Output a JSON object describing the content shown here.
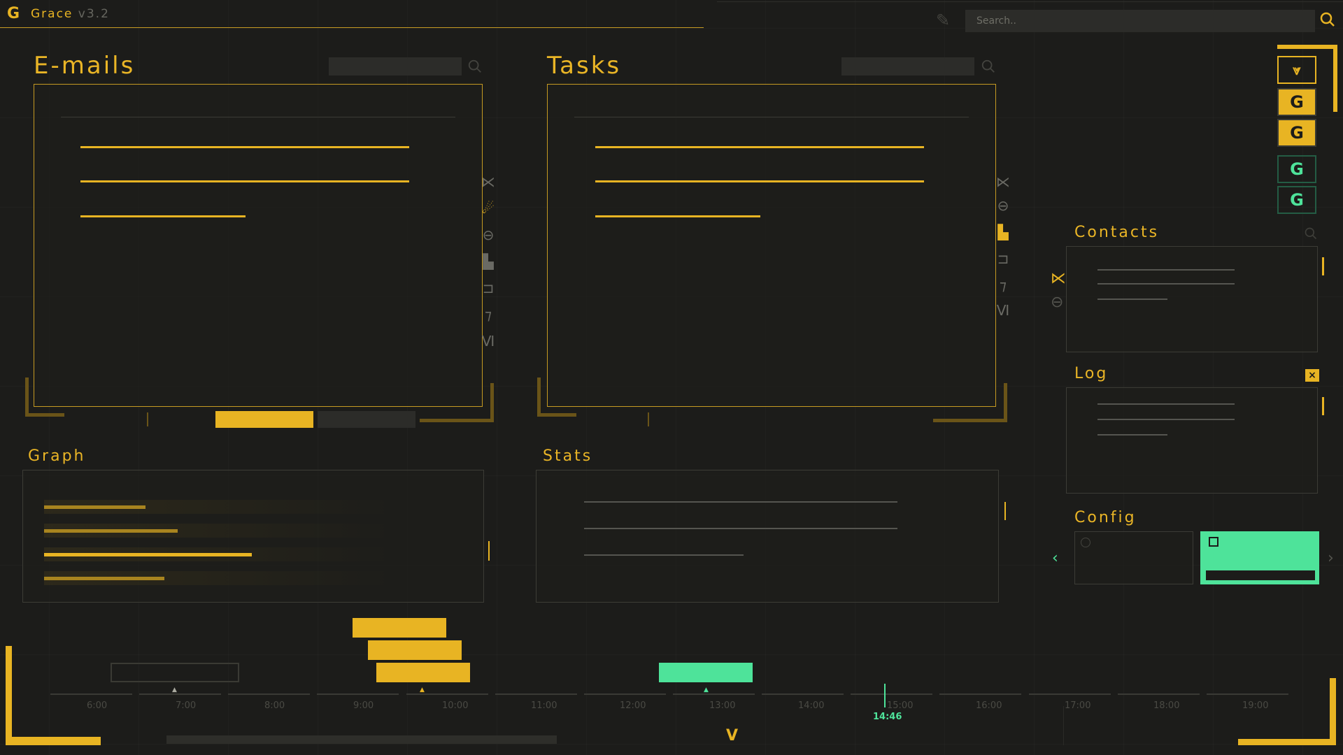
{
  "app": {
    "name": "Grace",
    "version": "v3.2"
  },
  "search": {
    "placeholder": "Search.."
  },
  "panels": {
    "emails": {
      "title": "E-mails"
    },
    "tasks": {
      "title": "Tasks"
    },
    "contacts": {
      "title": "Contacts"
    },
    "log": {
      "title": "Log"
    },
    "graph": {
      "title": "Graph"
    },
    "stats": {
      "title": "Stats"
    },
    "config": {
      "title": "Config"
    }
  },
  "email_icons": [
    "kick-icon",
    "comet-icon",
    "link-icon",
    "bars-icon",
    "return-icon",
    "seven-icon",
    "vi-icon"
  ],
  "task_icons": [
    "kick-icon",
    "link-icon",
    "bars-icon",
    "return-icon",
    "seven-icon",
    "vi-icon"
  ],
  "graph_bars": [
    0.22,
    0.29,
    0.45,
    0.26
  ],
  "timeline": {
    "hours": [
      "6:00",
      "7:00",
      "8:00",
      "9:00",
      "10:00",
      "11:00",
      "12:00",
      "13:00",
      "14:00",
      "15:00",
      "16:00",
      "17:00",
      "18:00",
      "19:00"
    ],
    "current_time": "14:46"
  },
  "sidebar_buttons": [
    {
      "name": "collapse-button",
      "style": "outline"
    },
    {
      "name": "grace-button-1",
      "style": "yellow"
    },
    {
      "name": "grace-button-2",
      "style": "yellow"
    },
    {
      "name": "grace-button-3",
      "style": "green"
    },
    {
      "name": "grace-button-4",
      "style": "green"
    }
  ],
  "colors": {
    "accent": "#e8b423",
    "green": "#4ee39a",
    "bg": "#1c1c1a"
  }
}
